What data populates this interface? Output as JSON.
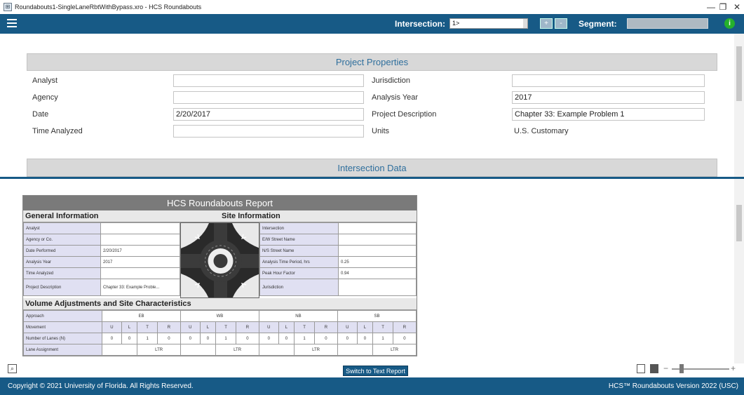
{
  "window": {
    "icon_glyph": "⊞",
    "title": "Roundabouts1-SingleLaneRbtWithBypass.xro - HCS Roundabouts",
    "controls": {
      "minimize": "—",
      "maximize": "❐",
      "close": "✕"
    }
  },
  "toolbar": {
    "intersection_label": "Intersection:",
    "intersection_value": "1>",
    "add_label": "+",
    "remove_label": "-",
    "segment_label": "Segment:",
    "segment_value": "",
    "info_glyph": "i"
  },
  "project": {
    "header": "Project Properties",
    "fields": {
      "analyst": {
        "label": "Analyst",
        "value": ""
      },
      "agency": {
        "label": "Agency",
        "value": ""
      },
      "date": {
        "label": "Date",
        "value": "2/20/2017"
      },
      "time_analyzed": {
        "label": "Time Analyzed",
        "value": ""
      },
      "jurisdiction": {
        "label": "Jurisdiction",
        "value": ""
      },
      "analysis_year": {
        "label": "Analysis Year",
        "value": "2017"
      },
      "project_description": {
        "label": "Project Description",
        "value": "Chapter 33: Example Problem 1"
      },
      "units": {
        "label": "Units",
        "value": "U.S. Customary"
      }
    },
    "intersection_data_header": "Intersection Data"
  },
  "report": {
    "title": "HCS Roundabouts Report",
    "general_info_header": "General Information",
    "site_info_header": "Site Information",
    "general": [
      {
        "label": "Analyst",
        "value": ""
      },
      {
        "label": "Agency or Co.",
        "value": ""
      },
      {
        "label": "Date Performed",
        "value": "2/20/2017"
      },
      {
        "label": "Analysis Year",
        "value": "2017"
      },
      {
        "label": "Time Analyzed",
        "value": ""
      },
      {
        "label": "Project Description",
        "value": "Chapter 33: Example Proble..."
      }
    ],
    "site": [
      {
        "label": "Intersection",
        "value": ""
      },
      {
        "label": "E/W Street Name",
        "value": ""
      },
      {
        "label": "N/S Street Name",
        "value": ""
      },
      {
        "label": "Analysis Time Period, hrs",
        "value": "0.25"
      },
      {
        "label": "Peak Hour Factor",
        "value": "0.94"
      },
      {
        "label": "Jurisdiction",
        "value": ""
      }
    ],
    "volume_header": "Volume Adjustments and Site Characteristics",
    "approach_label": "Approach",
    "approaches": [
      "EB",
      "WB",
      "NB",
      "SB"
    ],
    "movement_label": "Movement",
    "movements": [
      "U",
      "L",
      "T",
      "R"
    ],
    "lanes_label": "Number of Lanes (N)",
    "lanes": [
      [
        "0",
        "0",
        "1",
        "0"
      ],
      [
        "0",
        "0",
        "1",
        "0"
      ],
      [
        "0",
        "0",
        "1",
        "0"
      ],
      [
        "0",
        "0",
        "1",
        "0"
      ]
    ],
    "lane_assignment_label": "Lane Assignment",
    "lane_assignment": [
      "LTR",
      "LTR",
      "LTR",
      "LTR"
    ]
  },
  "bottom": {
    "switch_button": "Switch to Text Report",
    "zoom_minus": "−",
    "zoom_plus": "+",
    "zoom_level": 0.15
  },
  "footer": {
    "copyright": "Copyright © 2021 University of Florida. All Rights Reserved.",
    "version": "HCS™ Roundabouts Version 2022 (USC)"
  },
  "colors": {
    "brand_blue": "#175a86",
    "header_text_blue": "#2f6f9d",
    "info_green": "#25b02c",
    "label_row_bg": "#e0e0f2"
  }
}
